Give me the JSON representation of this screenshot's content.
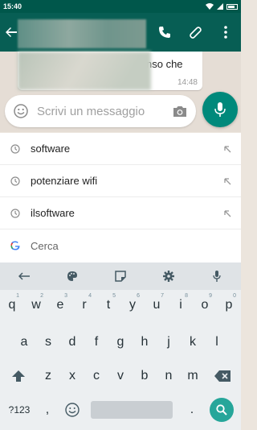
{
  "status_bar": {
    "time": "15:40"
  },
  "chat": {
    "partial_text": "nso che",
    "time": "14:48"
  },
  "composer": {
    "placeholder": "Scrivi un messaggio"
  },
  "suggestions": [
    {
      "label": "software",
      "icon": "history-icon"
    },
    {
      "label": "potenziare wifi",
      "icon": "history-icon"
    },
    {
      "label": "ilsoftware",
      "icon": "history-icon"
    },
    {
      "label": "Cerca",
      "icon": "google-icon"
    }
  ],
  "keyboard": {
    "toolbar": [
      "back-arrow-icon",
      "palette-icon",
      "sticker-icon",
      "settings-icon",
      "mic-icon"
    ],
    "row1": [
      "q",
      "w",
      "e",
      "r",
      "t",
      "y",
      "u",
      "i",
      "o",
      "p"
    ],
    "row1_hints": [
      "1",
      "2",
      "3",
      "4",
      "5",
      "6",
      "7",
      "8",
      "9",
      "0"
    ],
    "row2": [
      "a",
      "s",
      "d",
      "f",
      "g",
      "h",
      "j",
      "k",
      "l"
    ],
    "row3": [
      "z",
      "x",
      "c",
      "v",
      "b",
      "n",
      "m"
    ],
    "sym_label": "?123",
    "comma": ",",
    "period": "."
  },
  "colors": {
    "appbar": "#075e54",
    "statusbar": "#00574b",
    "accent": "#00897b",
    "search_fab": "#26a69a"
  }
}
